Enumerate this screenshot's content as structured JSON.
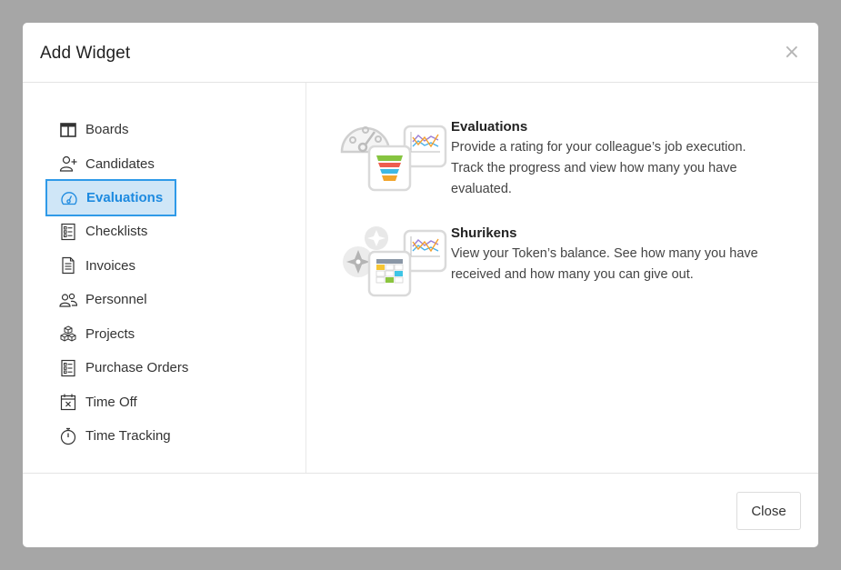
{
  "modal": {
    "title": "Add Widget",
    "close_icon": "close-icon"
  },
  "sidebar": {
    "items": [
      {
        "label": "Boards",
        "icon": "board-icon",
        "active": false
      },
      {
        "label": "Candidates",
        "icon": "user-plus-icon",
        "active": false
      },
      {
        "label": "Evaluations",
        "icon": "gauge-icon",
        "active": true
      },
      {
        "label": "Checklists",
        "icon": "checklist-icon",
        "active": false
      },
      {
        "label": "Invoices",
        "icon": "invoice-icon",
        "active": false
      },
      {
        "label": "Personnel",
        "icon": "users-icon",
        "active": false
      },
      {
        "label": "Projects",
        "icon": "cubes-icon",
        "active": false
      },
      {
        "label": "Purchase Orders",
        "icon": "purchase-order-icon",
        "active": false
      },
      {
        "label": "Time Off",
        "icon": "calendar-x-icon",
        "active": false
      },
      {
        "label": "Time Tracking",
        "icon": "stopwatch-icon",
        "active": false
      }
    ]
  },
  "widgets": [
    {
      "title": "Evaluations",
      "description": "Provide a rating for your colleague’s job execution. Track the progress and view how many you have evaluated.",
      "art": "evaluations-art"
    },
    {
      "title": "Shurikens",
      "description": "View your Token’s balance. See how many you have received and how many you can give out.",
      "art": "shurikens-art"
    }
  ],
  "footer": {
    "close_label": "Close"
  },
  "colors": {
    "accent": "#2f9ae8",
    "active_bg": "#cfe6f7",
    "backdrop": "#a6a6a6"
  }
}
